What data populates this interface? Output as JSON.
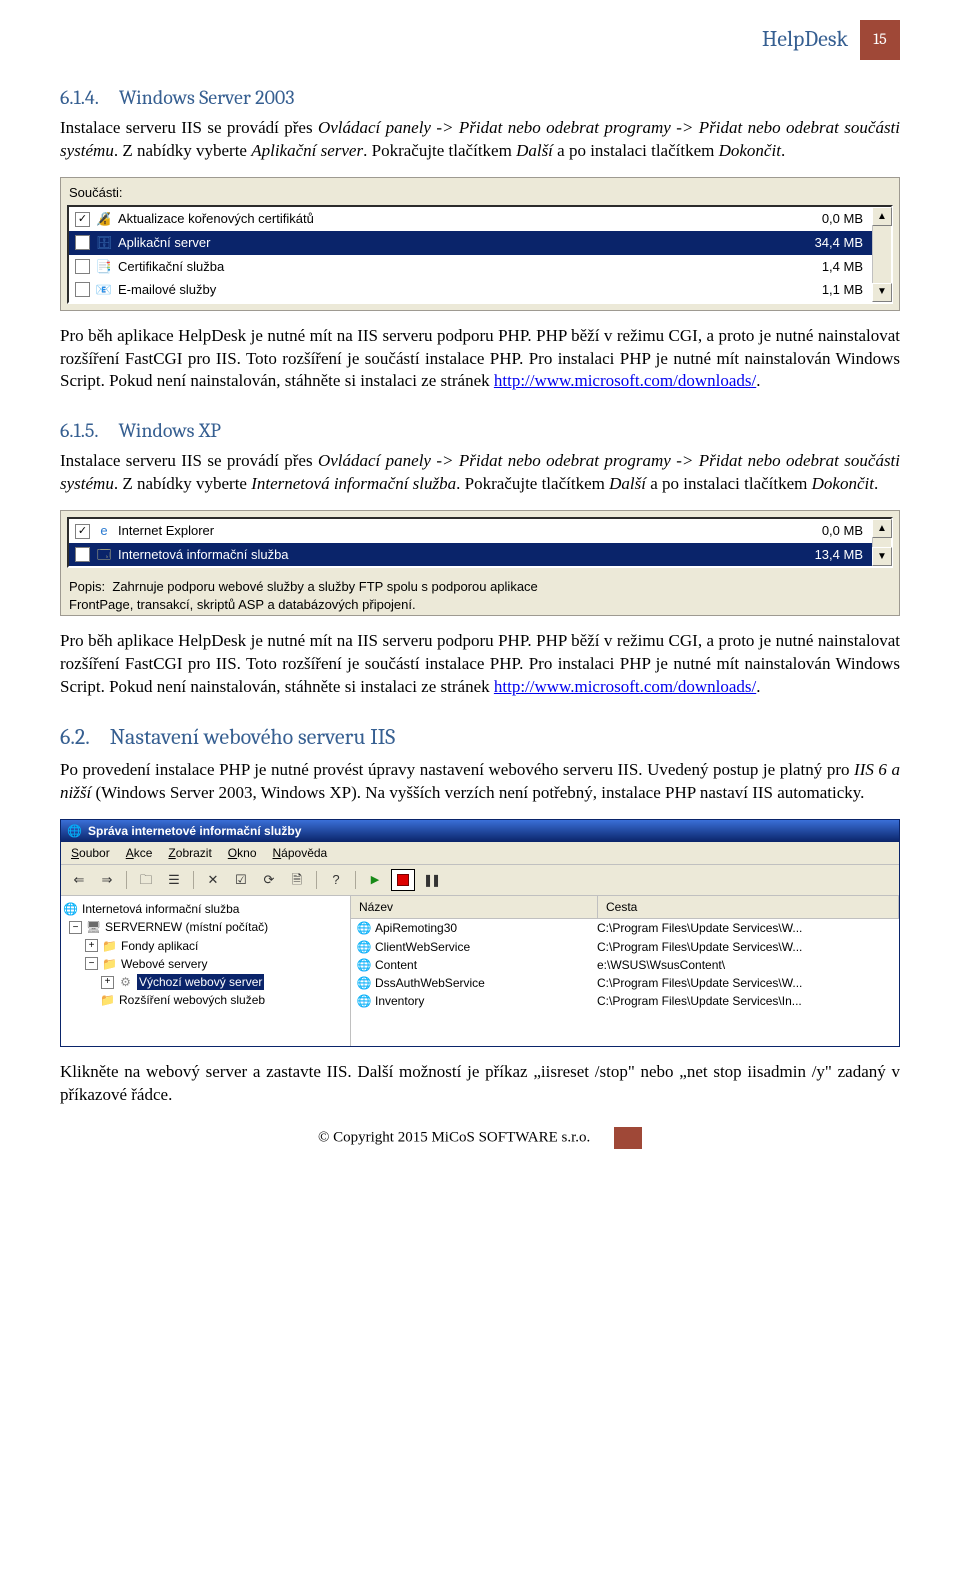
{
  "header": {
    "title": "HelpDesk",
    "page": "15"
  },
  "s614": {
    "num": "6.1.4.",
    "title": "Windows Server 2003",
    "p1a": "Instalace serveru IIS se provádí přes ",
    "p1b": "Ovládací panely -> Přidat nebo odebrat programy -> Přidat nebo odebrat součásti systému",
    "p1c": ". Z nabídky vyberte ",
    "p1d": "Aplikační server",
    "p1e": ". Pokračujte tlačítkem ",
    "p1f": "Další",
    "p1g": " a po instalaci tlačítkem ",
    "p1h": "Dokončit",
    "p1i": "."
  },
  "components1": {
    "label": "Součásti:",
    "rows": [
      {
        "checked": true,
        "icon": "ico-cert",
        "name": "Aktualizace kořenových certifikátů",
        "size": "0,0 MB",
        "selected": false
      },
      {
        "checked": true,
        "icon": "ico-srv",
        "name": "Aplikační server",
        "size": "34,4 MB",
        "selected": true
      },
      {
        "checked": false,
        "icon": "ico-cert2",
        "name": "Certifikační služba",
        "size": "1,4 MB",
        "selected": false
      },
      {
        "checked": false,
        "icon": "ico-mail",
        "name": "E-mailové služby",
        "size": "1,1 MB",
        "selected": false
      }
    ]
  },
  "para_after_c1": {
    "a": "Pro běh aplikace HelpDesk je nutné mít na IIS serveru podporu PHP. PHP běží v režimu CGI, a proto je nutné nainstalovat rozšíření FastCGI pro IIS. Toto rozšíření je součástí instalace PHP. Pro instalaci PHP je nutné mít nainstalován Windows Script. Pokud není nainstalován, stáhněte si instalaci ze stránek ",
    "link": "http://www.microsoft.com/downloads/",
    "b": "."
  },
  "s615": {
    "num": "6.1.5.",
    "title": "Windows XP",
    "p1a": "Instalace serveru IIS se provádí přes ",
    "p1b": "Ovládací panely -> Přidat nebo odebrat programy -> Přidat nebo odebrat součásti systému",
    "p1c": ". Z nabídky vyberte ",
    "p1d": "Internetová informační služba",
    "p1e": ". Pokračujte tlačítkem ",
    "p1f": "Další",
    "p1g": " a po instalaci tlačítkem ",
    "p1h": "Dokončit",
    "p1i": "."
  },
  "components2": {
    "rows": [
      {
        "checked": true,
        "icon": "ico-ie",
        "name": "Internet Explorer",
        "size": "0,0 MB",
        "selected": false
      },
      {
        "checked": true,
        "icon": "ico-iis",
        "name": "Internetová informační služba",
        "size": "13,4 MB",
        "selected": true
      }
    ],
    "popis_label": "Popis:",
    "popis_text": "Zahrnuje podporu webové služby a služby FTP spolu s podporou aplikace",
    "popis_text2": "FrontPage, transakcí, skriptů ASP a databázových připojení."
  },
  "para_after_c2": {
    "a": "Pro běh aplikace HelpDesk je nutné mít na IIS serveru podporu PHP. PHP běží v režimu CGI, a proto je nutné nainstalovat rozšíření FastCGI pro IIS. Toto rozšíření je součástí instalace PHP. Pro instalaci PHP je nutné mít nainstalován Windows Script. Pokud není nainstalován, stáhněte si instalaci ze stránek ",
    "link": "http://www.microsoft.com/downloads/",
    "b": "."
  },
  "s62": {
    "num": "6.2.",
    "title": "Nastavení webového serveru IIS",
    "p": "Po provedení instalace PHP je nutné provést úpravy nastavení webového serveru IIS. Uvedený postup je platný pro ",
    "p_it": "IIS 6 a nižší",
    "p2": " (Windows Server 2003, Windows XP). Na vyšších verzích není potřebný, instalace PHP nastaví IIS automaticky."
  },
  "mmc": {
    "title": "Správa internetové informační služby",
    "menu": [
      "Soubor",
      "Akce",
      "Zobrazit",
      "Okno",
      "Nápověda"
    ],
    "tree": {
      "root": "Internetová informační služba",
      "server": "SERVERNEW (místní počítač)",
      "items": [
        "Fondy aplikací",
        "Webové servery",
        "Výchozí webový server",
        "Rozšíření webových služeb"
      ]
    },
    "grid": {
      "col1": "Název",
      "col2": "Cesta",
      "rows": [
        {
          "name": "ApiRemoting30",
          "path": "C:\\Program Files\\Update Services\\W..."
        },
        {
          "name": "ClientWebService",
          "path": "C:\\Program Files\\Update Services\\W..."
        },
        {
          "name": "Content",
          "path": "e:\\WSUS\\WsusContent\\"
        },
        {
          "name": "DssAuthWebService",
          "path": "C:\\Program Files\\Update Services\\W..."
        },
        {
          "name": "Inventory",
          "path": "C:\\Program Files\\Update Services\\In..."
        }
      ]
    }
  },
  "final_para": "Klikněte na webový server a zastavte IIS. Další možností je příkaz „iisreset /stop\" nebo „net stop iisadmin /y\" zadaný v příkazové řádce.",
  "copyright": "© Copyright 2015 MiCoS SOFTWARE s.r.o."
}
